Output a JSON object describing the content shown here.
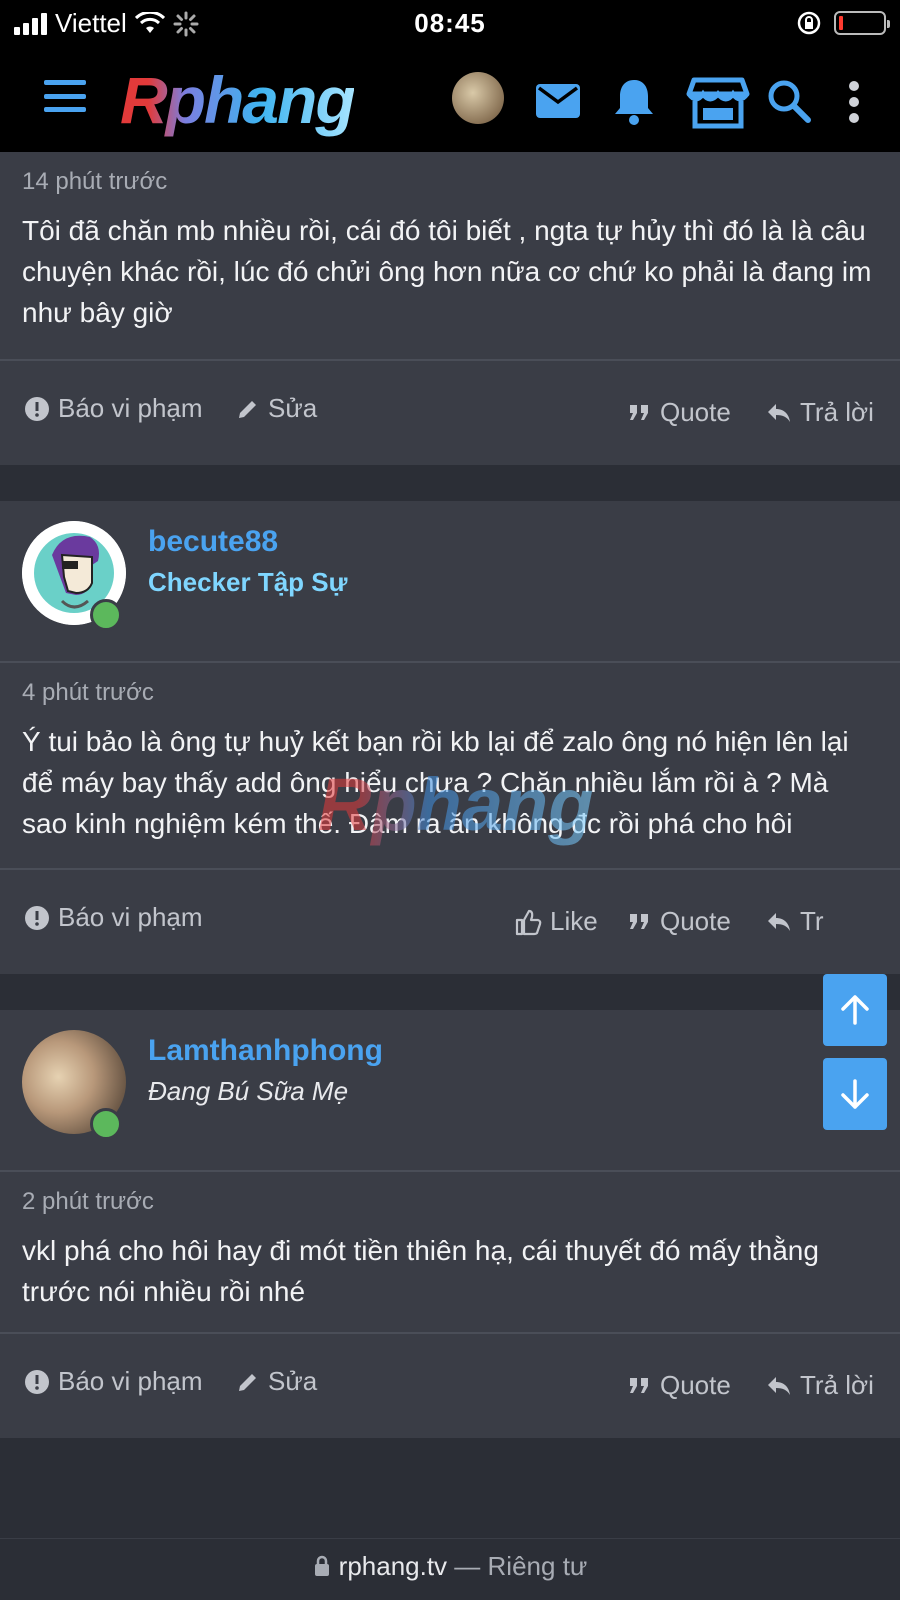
{
  "status_bar": {
    "carrier": "Viettel",
    "time": "08:45"
  },
  "header": {
    "logo": "Rphang",
    "icons": [
      "menu-icon",
      "avatar",
      "mail-icon",
      "bell-icon",
      "store-icon",
      "search-icon",
      "more-vertical-icon"
    ]
  },
  "posts": [
    {
      "time": "14 phút trước",
      "body": "Tôi đã chăn mb nhiều rồi, cái đó tôi biết , ngta tự hủy thì đó là là câu chuyện khác rồi, lúc đó chửi ông hơn nữa cơ chứ ko phải là đang im như bây giờ",
      "actions": {
        "report": "Báo vi phạm",
        "edit": "Sửa",
        "quote": "Quote",
        "reply": "Trả lời"
      }
    },
    {
      "username": "becute88",
      "user_title": "Checker Tập Sự",
      "time": "4 phút trước",
      "body": "Ý tui bảo là ông tự huỷ kết bạn rồi kb lại để zalo ông nó hiện lên lại để máy bay thấy add ông hiểu chưa ? Chăn nhiều lắm rồi à ? Mà sao kinh nghiệm kém thế. Đâm ra ăn không đc rồi phá cho hôi",
      "actions": {
        "report": "Báo vi phạm",
        "like": "Like",
        "quote": "Quote",
        "reply_partial": "Tr"
      }
    },
    {
      "username": "Lamthanhphong",
      "user_title": "Đang Bú Sữa Mẹ",
      "time": "2 phút trước",
      "body": "vkl phá cho hôi hay đi mót tiền thiên hạ, cái thuyết đó mấy thằng trước nói nhiều rồi nhé",
      "actions": {
        "report": "Báo vi phạm",
        "edit": "Sửa",
        "quote": "Quote",
        "reply": "Trả lời"
      }
    }
  ],
  "watermark": "Rphang",
  "url_bar": {
    "domain": "rphang.tv",
    "separator": "—",
    "label": "Riêng tư"
  },
  "colors": {
    "accent": "#4aa3f0",
    "user_title_cyan": "#7fd6ff",
    "online": "#5cb85c",
    "post_bg": "#3a3d46",
    "page_bg": "#2b2e36"
  }
}
